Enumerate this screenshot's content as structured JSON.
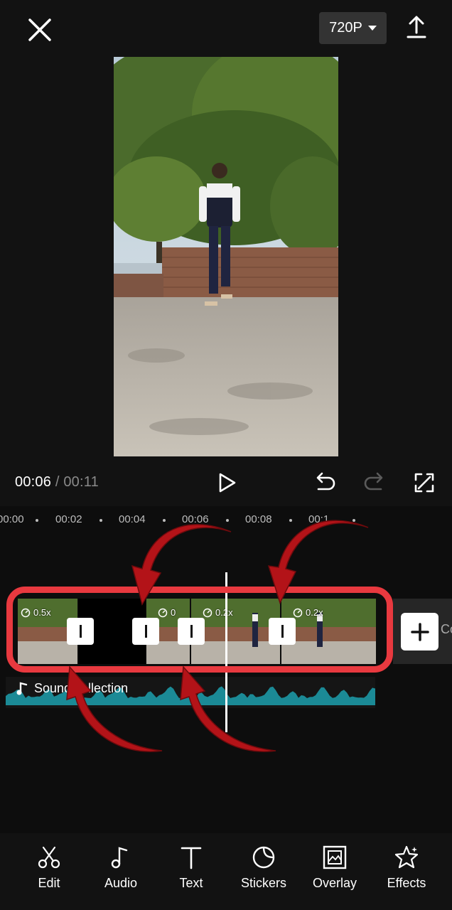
{
  "header": {
    "resolution": "720P"
  },
  "player": {
    "current_time": "00:06",
    "separator": "/",
    "total_time": "00:11"
  },
  "ruler": {
    "ticks": [
      "00:00",
      "00:02",
      "00:04",
      "00:06",
      "00:08",
      "00:1"
    ]
  },
  "clips": [
    {
      "speed": "0.5x"
    },
    {
      "speed": ""
    },
    {
      "speed": "0"
    },
    {
      "speed": "0.2x"
    },
    {
      "speed": "0.2x"
    }
  ],
  "cover": {
    "label": "Cove"
  },
  "audio": {
    "label": "Sound collection"
  },
  "toolbar": {
    "items": [
      {
        "label": "Edit",
        "icon": "scissors-icon"
      },
      {
        "label": "Audio",
        "icon": "music-note-icon"
      },
      {
        "label": "Text",
        "icon": "text-icon"
      },
      {
        "label": "Stickers",
        "icon": "sticker-icon"
      },
      {
        "label": "Overlay",
        "icon": "overlay-icon"
      },
      {
        "label": "Effects",
        "icon": "star-icon"
      }
    ]
  },
  "colors": {
    "background": "#121212",
    "highlight": "#e8393f",
    "waveform": "#1b8a96",
    "arrow": "#b31318"
  }
}
